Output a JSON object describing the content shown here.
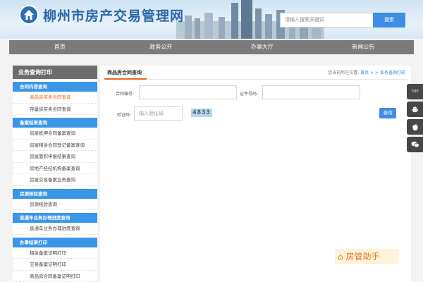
{
  "header": {
    "site_title": "柳州市房产交易管理网",
    "search_placeholder": "请输入搜索关键词",
    "search_button": "搜索"
  },
  "nav": {
    "items": [
      "首页",
      "政务公开",
      "办事大厅",
      "新闻公告"
    ]
  },
  "sidebar": {
    "title": "业务查询打印",
    "groups": [
      {
        "name": "合同内容查询",
        "items": [
          "商品房买卖合同查询",
          "存量房买卖合同查询"
        ]
      },
      {
        "name": "备案结果查询",
        "items": [
          "房屋抵押合同备案查询",
          "房屋租赁合同登记备案查询",
          "房屋面积申报结果查询",
          "房地产经纪机构备案查询",
          "房屋交易备案业务查询"
        ]
      },
      {
        "name": "房源核验查询",
        "items": [
          "房源核验查询"
        ]
      },
      {
        "name": "直通车业务办理进度查询",
        "items": [
          "直通车业务办理进度查询"
        ]
      },
      {
        "name": "办事结果打印",
        "items": [
          "租赁备案证明打印",
          "交易备案证明打印",
          "商品房合同备案证明打印"
        ]
      }
    ],
    "active_item": "商品房买卖合同查询"
  },
  "main": {
    "title": "商品房合同查询",
    "breadcrumb": {
      "prefix": "您当前所在位置:",
      "home": "首页",
      "sep": "> >",
      "current": "业务查询打印"
    },
    "contract_label": "合同编号:",
    "contract_value": "",
    "id_label": "证件号码:",
    "id_value": "",
    "captcha_label": "验证码:",
    "captcha_placeholder": "输入验证码",
    "captcha_text": "4833",
    "query_button": "查询"
  },
  "float_bar": {
    "top_label": "TOP"
  },
  "watermark": "房管助手"
}
